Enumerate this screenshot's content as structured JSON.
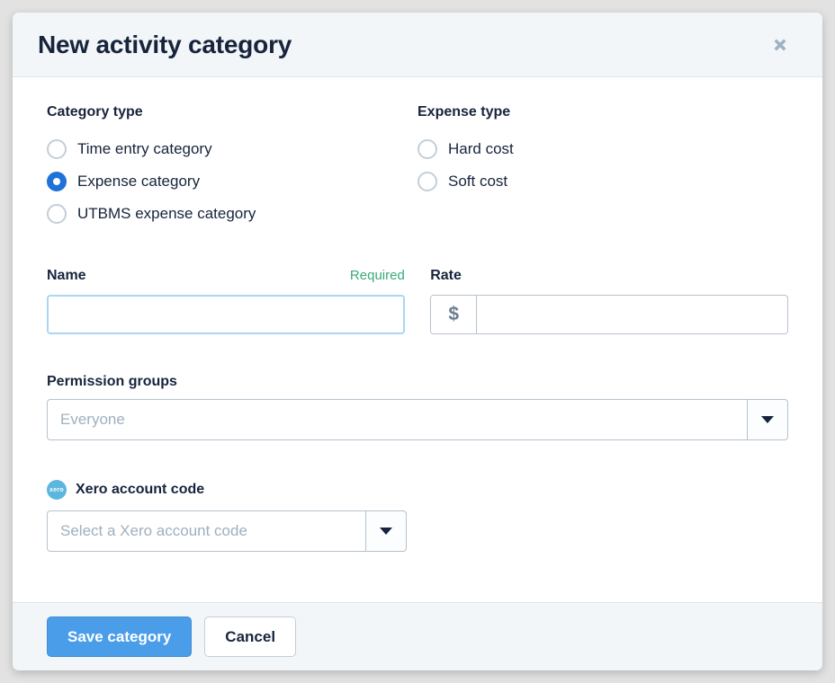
{
  "modal": {
    "title": "New activity category",
    "close_icon": "close-icon"
  },
  "category_type": {
    "label": "Category type",
    "options": [
      {
        "label": "Time entry category",
        "selected": false
      },
      {
        "label": "Expense category",
        "selected": true
      },
      {
        "label": "UTBMS expense category",
        "selected": false
      }
    ]
  },
  "expense_type": {
    "label": "Expense type",
    "options": [
      {
        "label": "Hard cost",
        "selected": false
      },
      {
        "label": "Soft cost",
        "selected": false
      }
    ]
  },
  "name_field": {
    "label": "Name",
    "required_tag": "Required",
    "value": "",
    "placeholder": ""
  },
  "rate_field": {
    "label": "Rate",
    "currency_symbol": "$",
    "value": "",
    "placeholder": ""
  },
  "permission_groups": {
    "label": "Permission groups",
    "value": "Everyone",
    "caret_icon": "chevron-down-icon"
  },
  "xero": {
    "label": "Xero account code",
    "icon_text": "xero",
    "value": "Select a Xero account code",
    "caret_icon": "chevron-down-icon"
  },
  "footer": {
    "save_label": "Save category",
    "cancel_label": "Cancel"
  },
  "colors": {
    "accent_blue": "#1e72d8",
    "button_blue": "#4a9de8",
    "required_green": "#3aaa7a",
    "xero_blue": "#5cb7df",
    "header_bg": "#f2f6f9",
    "text_dark": "#17243b"
  }
}
